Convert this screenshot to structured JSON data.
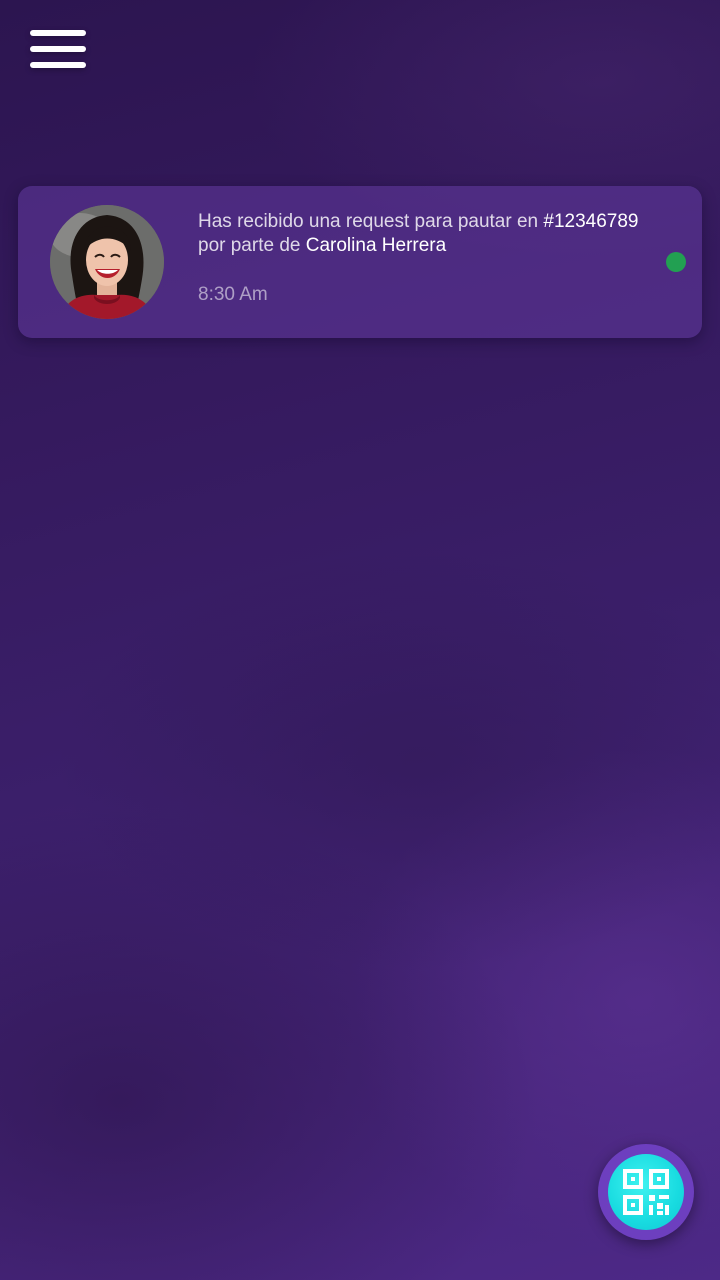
{
  "header": {
    "menu_icon": "hamburger-menu-icon"
  },
  "notifications": [
    {
      "avatar_icon": "user-avatar",
      "message_prefix": "Has recibido una request para pautar en ",
      "request_id": "#12346789",
      "message_middle": "por parte de ",
      "sender": "Carolina Herrera",
      "time": "8:30 Am",
      "unread": true,
      "unread_color": "#22a052"
    }
  ],
  "fab": {
    "icon": "qr-code-icon",
    "color": "#18dbe0"
  },
  "colors": {
    "background": "#3b1f6a",
    "card": "#623aa0",
    "accent": "#18dbe0"
  }
}
